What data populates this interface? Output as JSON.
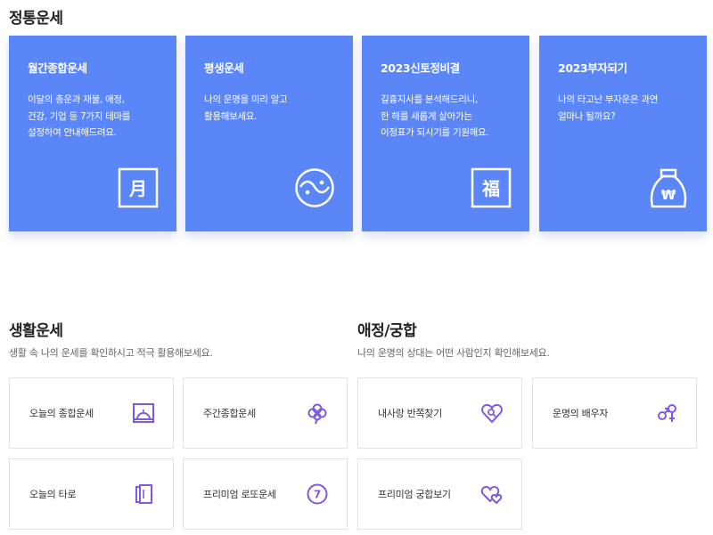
{
  "main": {
    "title": "정통운세",
    "cards": [
      {
        "title": "월간종합운세",
        "desc": "이달의 총운과 재물, 애정,\n건강, 기업 등 7가지 테마를\n설정하여 안내해드려요.",
        "icon": "moon-character-icon",
        "icon_char": "月"
      },
      {
        "title": "평생운세",
        "desc": "나의 운명을 미리 알고\n활용해보세요.",
        "icon": "yin-yang-icon"
      },
      {
        "title": "2023신토정비결",
        "desc": "길흉지사를 분석해드리니,\n한 해를 새롭게 살아가는\n이정표가 되시기를 기원해요.",
        "icon": "fortune-character-icon",
        "icon_char": "福"
      },
      {
        "title": "2023부자되기",
        "desc": "나의 타고난 부자운은 과연\n얼마나 될까요?",
        "icon": "money-bag-icon",
        "icon_char": "₩"
      }
    ]
  },
  "life": {
    "title": "생활운세",
    "desc": "생활 속 나의 운세를 확인하시고 적극 활용해보세요.",
    "items": [
      {
        "label": "오늘의 종합운세",
        "icon": "sunrise-icon"
      },
      {
        "label": "주간종합운세",
        "icon": "clover-icon"
      },
      {
        "label": "오늘의 타로",
        "icon": "tarot-cards-icon"
      },
      {
        "label": "프리미엄 로또운세",
        "icon": "lotto-ball-icon",
        "icon_char": "7"
      }
    ]
  },
  "love": {
    "title": "애정/궁합",
    "desc": "나의 운명의 상대는 어떤 사람인지 확인해보세요.",
    "items": [
      {
        "label": "내사랑 반쪽찾기",
        "icon": "heart-search-icon"
      },
      {
        "label": "운명의 배우자",
        "icon": "gender-symbols-icon"
      },
      {
        "label": "프리미엄 궁합보기",
        "icon": "double-heart-icon"
      }
    ]
  },
  "colors": {
    "card_bg": "#5b86f7",
    "icon_purple": "#7e5ae0"
  }
}
